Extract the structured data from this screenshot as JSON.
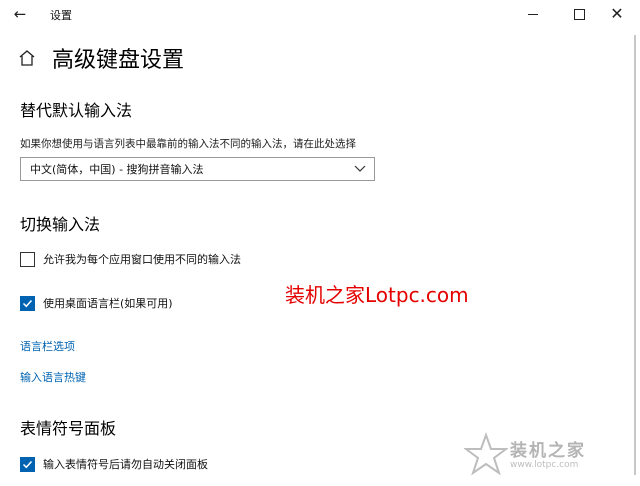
{
  "window": {
    "back_icon": "arrow-left-icon",
    "title": "设置",
    "minimize_icon": "minimize-icon",
    "maximize_icon": "maximize-icon",
    "close_icon": "close-icon"
  },
  "page": {
    "home_icon": "home-icon",
    "title": "高级键盘设置"
  },
  "override_section": {
    "heading": "替代默认输入法",
    "description": "如果你想使用与语言列表中最靠前的输入法不同的输入法，请在此处选择",
    "dropdown_value": "中文(简体，中国) - 搜狗拼音输入法"
  },
  "switch_section": {
    "heading": "切换输入法",
    "options": [
      {
        "label": "允许我为每个应用窗口使用不同的输入法",
        "checked": false
      },
      {
        "label": "使用桌面语言栏(如果可用)",
        "checked": true
      }
    ],
    "links": [
      "语言栏选项",
      "输入语言热键"
    ]
  },
  "emoji_section": {
    "heading": "表情符号面板",
    "options": [
      {
        "label": "输入表情符号后请勿自动关闭面板",
        "checked": true
      }
    ]
  },
  "watermark": {
    "text": "装机之家Lotpc.com",
    "color": "#e50000"
  },
  "logo_watermark": {
    "text": "装机之家",
    "url": "www.lotpc.com"
  },
  "colors": {
    "accent": "#0063b1",
    "background": "#ffffff"
  }
}
